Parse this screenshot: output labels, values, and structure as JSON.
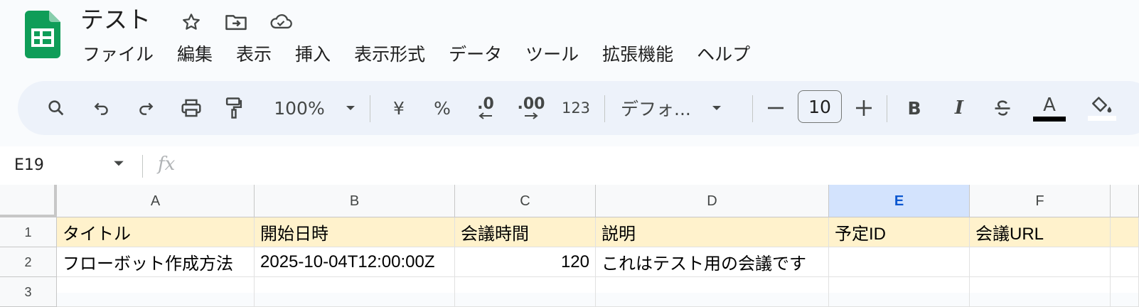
{
  "app": {
    "doc_title": "テスト",
    "brand_color": "#0f9d58"
  },
  "title_icons": [
    "star-icon",
    "move-to-folder-icon",
    "cloud-saved-icon"
  ],
  "menu": [
    "ファイル",
    "編集",
    "表示",
    "挿入",
    "表示形式",
    "データ",
    "ツール",
    "拡張機能",
    "ヘルプ"
  ],
  "toolbar": {
    "zoom": "100%",
    "currency": "¥",
    "percent": "%",
    "decrease_decimal": ".0",
    "increase_decimal": ".00",
    "number_format": "123",
    "font": "デフォ...",
    "font_size": "10",
    "bold": "B",
    "italic": "I",
    "text_color": "A"
  },
  "formula_bar": {
    "cell_ref": "E19",
    "fx": "fx",
    "value": ""
  },
  "grid": {
    "columns": [
      "A",
      "B",
      "C",
      "D",
      "E",
      "F"
    ],
    "selected_column": "E",
    "rows": [
      {
        "num": "1",
        "cells": [
          "タイトル",
          "開始日時",
          "会議時間",
          "説明",
          "予定ID",
          "会議URL"
        ]
      },
      {
        "num": "2",
        "cells": [
          "フローボット作成方法",
          "2025-10-04T12:00:00Z",
          "120",
          "これはテスト用の会議です",
          "",
          ""
        ]
      },
      {
        "num": "3",
        "cells": [
          "",
          "",
          "",
          "",
          "",
          ""
        ]
      }
    ]
  }
}
